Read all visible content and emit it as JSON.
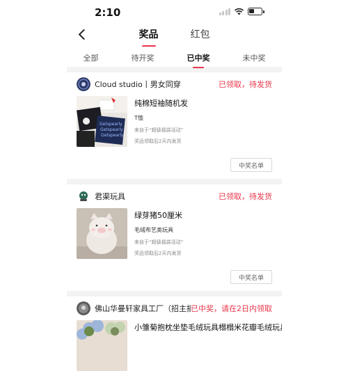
{
  "status_bar": {
    "time": "2:10"
  },
  "nav": {
    "tabs": [
      {
        "label": "奖品",
        "active": true
      },
      {
        "label": "红包",
        "active": false
      }
    ]
  },
  "sub_tabs": [
    {
      "label": "全部",
      "active": false
    },
    {
      "label": "待开奖",
      "active": false
    },
    {
      "label": "已中奖",
      "active": true
    },
    {
      "label": "未中奖",
      "active": false
    }
  ],
  "prizes": [
    {
      "shop_name": "Cloud studio丨男女同穿",
      "status": "已领取，待发货",
      "title": "纯棉短袖随机发",
      "tag": "T恤",
      "source": "来自于“超级福袋活动”",
      "shipping": "奖品领取后2天内发货",
      "button": "中奖名单",
      "avatar_icon": "cloud-studio-logo",
      "thumb_icon": "tshirts-photo"
    },
    {
      "shop_name": "君渠玩具",
      "status": "已领取，待发货",
      "title": "绿芽猪50厘米",
      "tag": "毛绒布艺类玩具",
      "source": "来自于“超级福袋活动”",
      "shipping": "奖品领取后2天内发货",
      "button": "中奖名单",
      "avatar_icon": "toy-shop-logo",
      "thumb_icon": "plush-pig-photo"
    },
    {
      "shop_name": "佛山华曼轩家具工厂（招主播）",
      "status": "已中奖，请在2日内领取",
      "title": "小雏菊抱枕坐垫毛绒玩具榻榻米花瓣毛绒玩具...",
      "avatar_icon": "furniture-shop-logo",
      "thumb_icon": "daisy-cushion-photo"
    }
  ],
  "colors": {
    "accent": "#e8354a",
    "divider": "#f3f3f3"
  }
}
